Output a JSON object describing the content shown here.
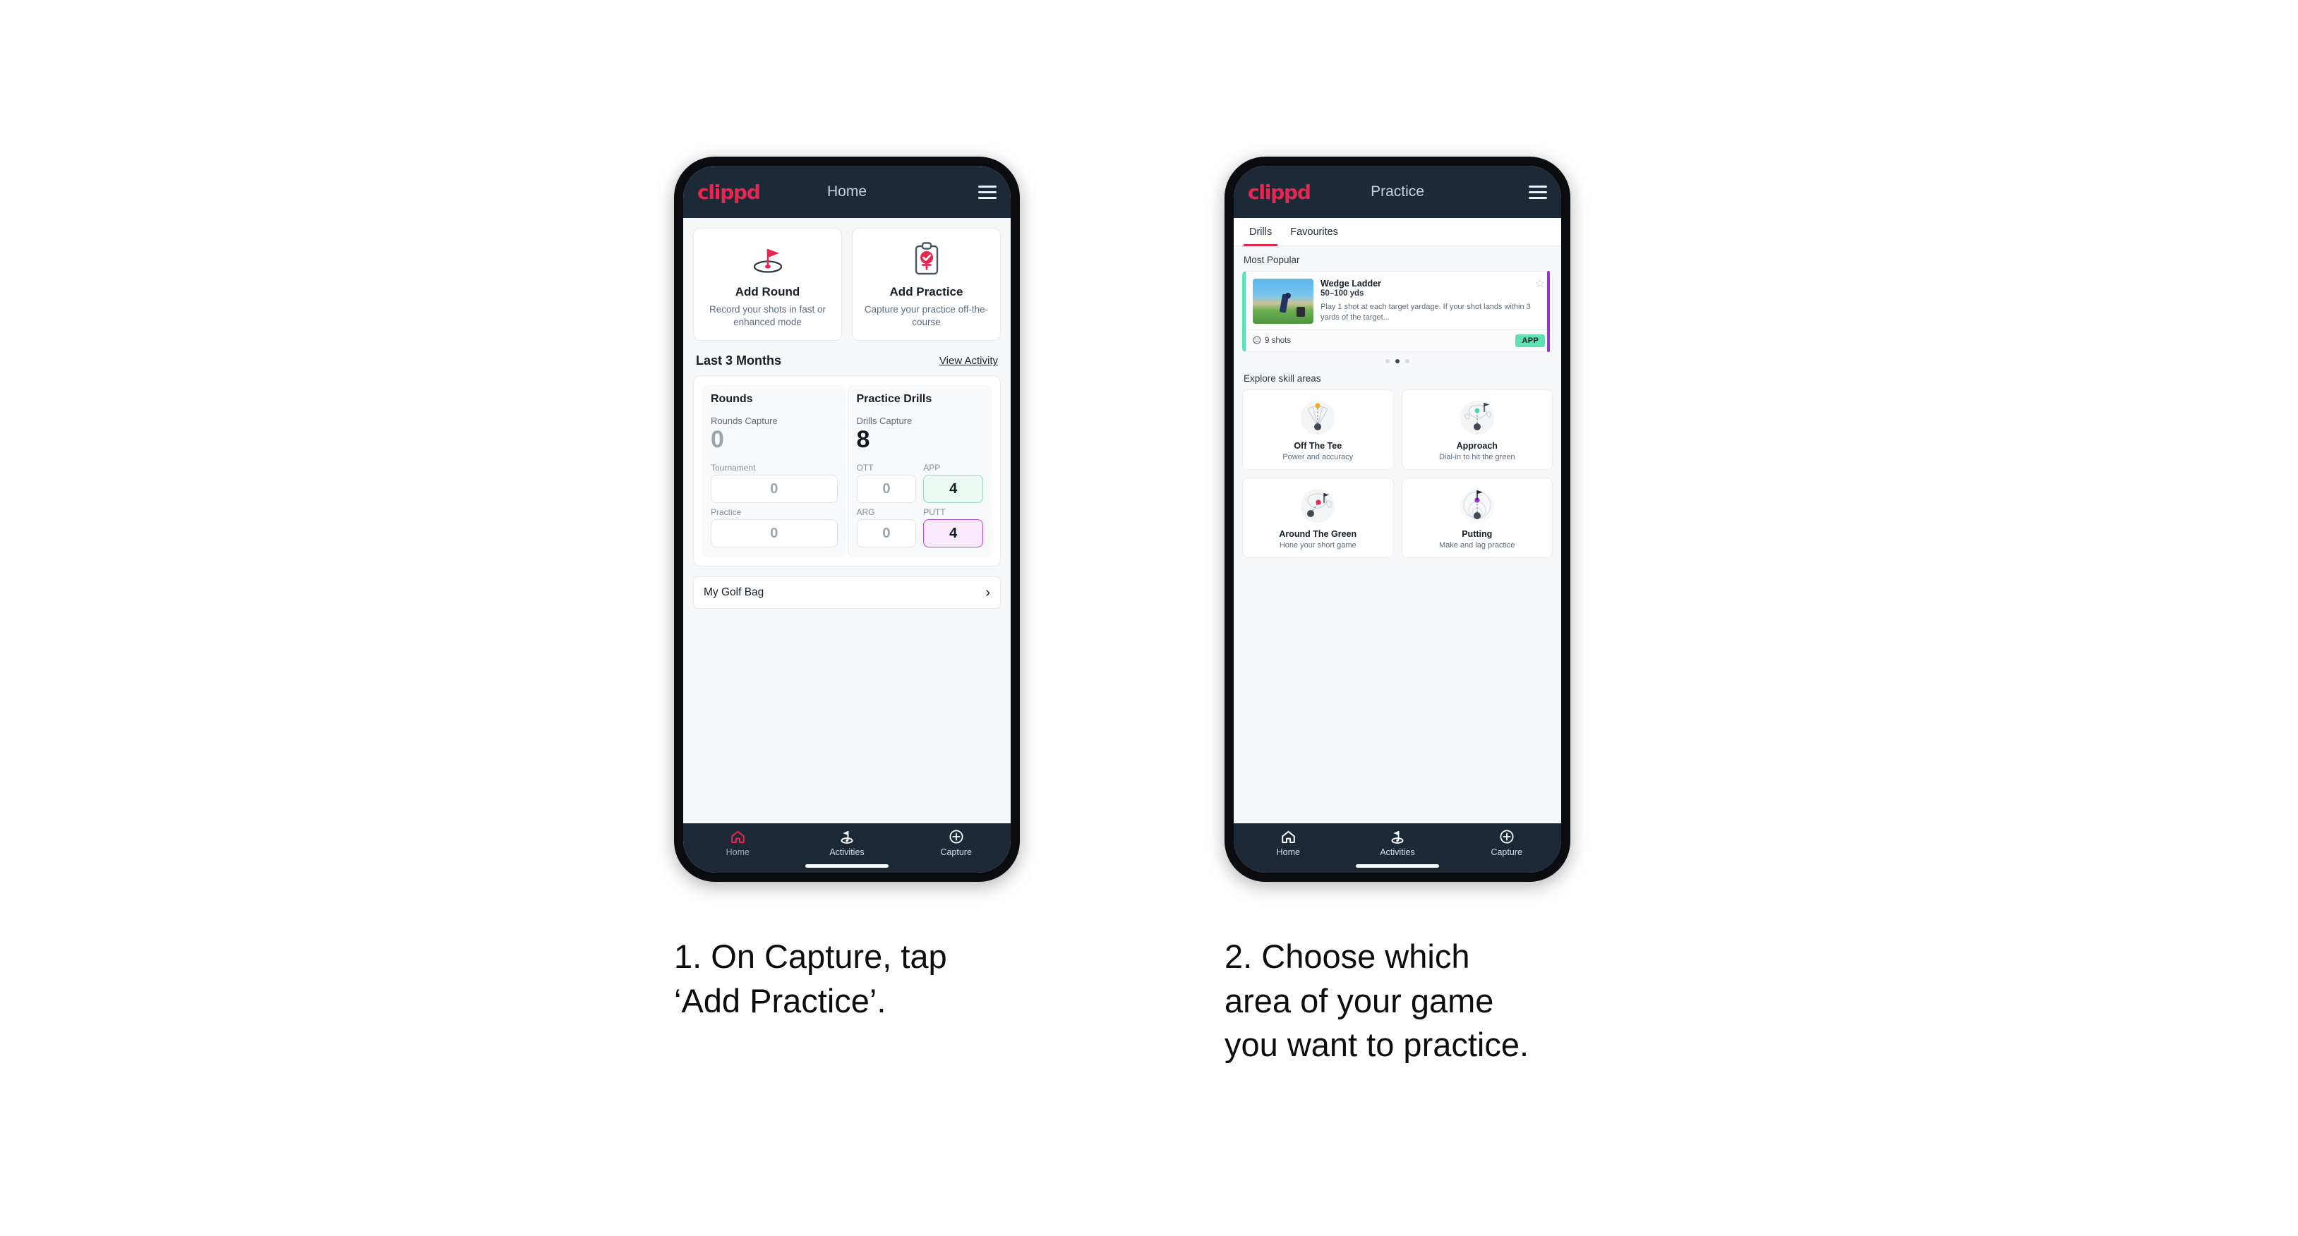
{
  "phone1": {
    "header": {
      "brand": "clippd",
      "title": "Home",
      "menu_icon": "hamburger-icon"
    },
    "actions": [
      {
        "icon": "golf-flag-icon",
        "title": "Add Round",
        "subtitle": "Record your shots in fast or enhanced mode"
      },
      {
        "icon": "clipboard-check-icon",
        "title": "Add Practice",
        "subtitle": "Capture your practice off-the-course"
      }
    ],
    "section": {
      "title": "Last 3 Months",
      "link": "View Activity"
    },
    "stats": {
      "rounds": {
        "heading": "Rounds",
        "capture_label": "Rounds Capture",
        "capture_value": "0",
        "items": [
          {
            "label": "Tournament",
            "value": "0",
            "state": "empty"
          },
          {
            "label": "Practice",
            "value": "0",
            "state": "empty"
          }
        ]
      },
      "drills": {
        "heading": "Practice Drills",
        "capture_label": "Drills Capture",
        "capture_value": "8",
        "items": [
          {
            "label": "OTT",
            "value": "0",
            "state": "empty"
          },
          {
            "label": "APP",
            "value": "4",
            "state": "app"
          },
          {
            "label": "ARG",
            "value": "0",
            "state": "empty"
          },
          {
            "label": "PUTT",
            "value": "4",
            "state": "putt"
          }
        ]
      }
    },
    "golf_bag": {
      "label": "My Golf Bag",
      "chevron": "chevron-right-icon"
    },
    "nav": [
      {
        "icon": "home-icon",
        "label": "Home",
        "active": true
      },
      {
        "icon": "golf-flag-icon",
        "label": "Activities",
        "active": false
      },
      {
        "icon": "plus-circle-icon",
        "label": "Capture",
        "active": false
      }
    ]
  },
  "phone2": {
    "header": {
      "brand": "clippd",
      "title": "Practice",
      "menu_icon": "hamburger-icon"
    },
    "tabs": [
      {
        "label": "Drills",
        "active": true
      },
      {
        "label": "Favourites",
        "active": false
      }
    ],
    "most_popular_label": "Most Popular",
    "drill": {
      "title": "Wedge Ladder",
      "yardage": "50–100 yds",
      "description": "Play 1 shot at each target yardage. If your shot lands within 3 yards of the target...",
      "shots": "9 shots",
      "badge": "APP",
      "star_icon": "star-outline-icon",
      "clock_icon": "clock-icon"
    },
    "carousel_dots": {
      "count": 3,
      "active_index": 1
    },
    "explore_label": "Explore skill areas",
    "skills": [
      {
        "icon": "off-the-tee-icon",
        "title": "Off The Tee",
        "subtitle": "Power and accuracy"
      },
      {
        "icon": "approach-icon",
        "title": "Approach",
        "subtitle": "Dial-in to hit the green"
      },
      {
        "icon": "around-the-green-icon",
        "title": "Around The Green",
        "subtitle": "Hone your short game"
      },
      {
        "icon": "putting-icon",
        "title": "Putting",
        "subtitle": "Make and lag practice"
      }
    ],
    "nav": [
      {
        "icon": "home-icon",
        "label": "Home",
        "active": false
      },
      {
        "icon": "golf-flag-icon",
        "label": "Activities",
        "active": false
      },
      {
        "icon": "plus-circle-icon",
        "label": "Capture",
        "active": false
      }
    ]
  },
  "captions": {
    "one": "1. On Capture, tap\n‘Add Practice’.",
    "two": "2. Choose which\narea of your game\nyou want to practice."
  },
  "colors": {
    "brand_pink": "#e8264f",
    "header_navy": "#1c2a38",
    "app_mint": "#5fdfb4",
    "putt_purple": "#b546d6",
    "scroll_purple": "#9b2fd6"
  }
}
